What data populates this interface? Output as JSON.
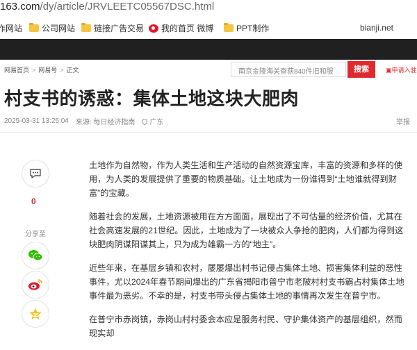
{
  "address_bar": {
    "host": "163.com",
    "path": "/dy/article/JRVLEETC05567DSC.html"
  },
  "bookmarks": [
    {
      "label": "作网站",
      "icon": "none"
    },
    {
      "label": "公司网站",
      "icon": "folder-icon"
    },
    {
      "label": "链接广告交易",
      "icon": "folder-icon"
    },
    {
      "label": "我的首页 微博",
      "icon": "weibo-icon"
    },
    {
      "label": "PPT制作",
      "icon": "folder-icon"
    }
  ],
  "bookmarks_right": "bianji.net",
  "breadcrumb": [
    "网易首页",
    "网易号",
    "正文"
  ],
  "search": {
    "placeholder": "南京金陵海关查获840件旧和服",
    "button": "搜索"
  },
  "register_label": "申请入驻",
  "article": {
    "title": "村支书的诱惑：集体土地这块大肥肉",
    "datetime": "2025-03-31 13:25:04",
    "source": "来源: 每日经济指南",
    "location": "广东",
    "report": "举报",
    "paragraphs": [
      "土地作为自然物，作为人类生活和生产活动的自然资源宝库，丰富的资源和多样的使用，为人类的发展提供了重要的物质基础。让土地成为一份谁得到“土地谁就得到财富”的宝藏。",
      "随着社会的发展，土地资源被用在方方面面，展现出了不可估量的经济价值，尤其在社会高速发展的21世纪。因此，土地成为了一块被众人争抢的肥肉，人们都为得到这块肥肉阴谋阳谋其上，只为成为雄霸一方的“地主”。",
      "近些年来，在基层乡镇和农村，屡屡爆出村书记侵占集体土地、损害集体利益的恶性事件，尤以2024年春节期间爆出的广东省揭阳市普宁市老陂村村支书霸占村集体土地事件最为恶劣。不幸的是，村支书带头侵占集体土地的事情再次发生在普宁市。",
      "在普宁市赤岗镇，赤岗山村村委会本应是服务村民、守护集体资产的基层组织，然而现实却"
    ]
  },
  "sidebar": {
    "comment_count": "0",
    "share_label": "分享至"
  },
  "colors": {
    "accent": "#e0292e",
    "dark_header": "#202020",
    "wechat": "#2dc100",
    "weibo": "#e6162d"
  }
}
